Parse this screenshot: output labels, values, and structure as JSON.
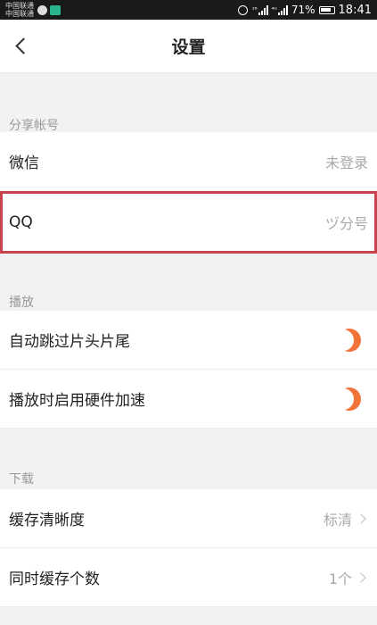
{
  "status_bar": {
    "carrier1": "中国联通",
    "carrier2": "中国联通",
    "battery": "71%",
    "time": "18:41",
    "signal1": "²⁶",
    "signal2": "⁴ᴳ"
  },
  "header": {
    "title": "设置"
  },
  "sections": {
    "share": {
      "title": "分享帐号",
      "wechat_label": "微信",
      "wechat_value": "未登录",
      "qq_label": "QQ",
      "qq_value": "ヅ分号"
    },
    "playback": {
      "title": "播放",
      "skip_label": "自动跳过片头片尾",
      "hw_label": "播放时启用硬件加速"
    },
    "download": {
      "title": "下载",
      "quality_label": "缓存清晰度",
      "quality_value": "标清",
      "count_label": "同时缓存个数",
      "count_value": "1个"
    }
  },
  "colors": {
    "accent": "#f0733a",
    "highlight": "#c8454f"
  }
}
